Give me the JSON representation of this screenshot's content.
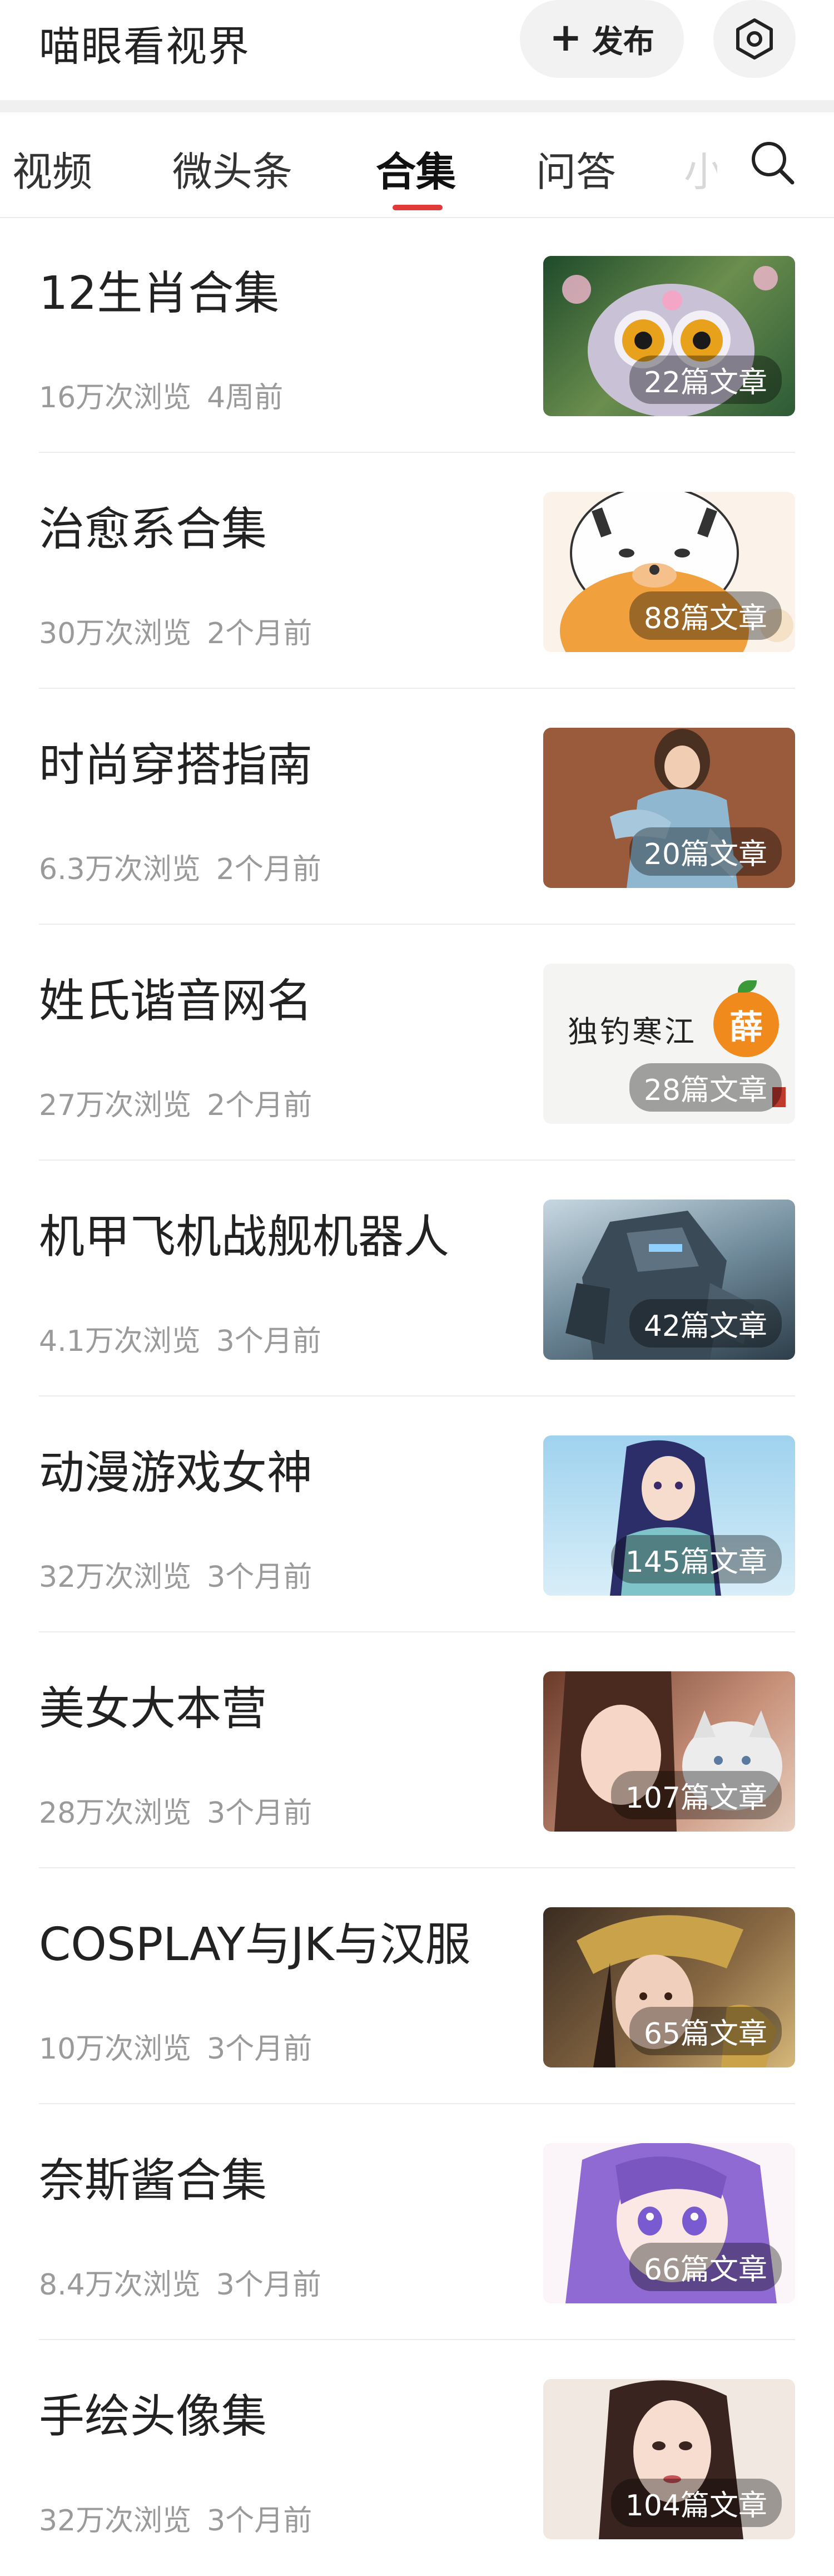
{
  "header": {
    "title": "喵眼看视界",
    "publish_label": "发布"
  },
  "tabs": [
    {
      "label": "视频"
    },
    {
      "label": "微头条"
    },
    {
      "label": "合集",
      "active": true
    },
    {
      "label": "问答"
    }
  ],
  "tab_overflow": "小",
  "collections": [
    {
      "title": "12生肖合集",
      "views": "16万次浏览",
      "time": "4周前",
      "count": "22篇文章",
      "thumb": "owl-creature"
    },
    {
      "title": "治愈系合集",
      "views": "30万次浏览",
      "time": "2个月前",
      "count": "88篇文章",
      "thumb": "cartoon-tiger"
    },
    {
      "title": "时尚穿搭指南",
      "views": "6.3万次浏览",
      "time": "2个月前",
      "count": "20篇文章",
      "thumb": "fashion-girl"
    },
    {
      "title": "姓氏谐音网名",
      "views": "27万次浏览",
      "time": "2个月前",
      "count": "28篇文章",
      "thumb": "calligraphy",
      "thumb_text": "独钓寒江",
      "thumb_seal": "薛"
    },
    {
      "title": "机甲飞机战舰机器人",
      "views": "4.1万次浏览",
      "time": "3个月前",
      "count": "42篇文章",
      "thumb": "mech-robot"
    },
    {
      "title": "动漫游戏女神",
      "views": "32万次浏览",
      "time": "3个月前",
      "count": "145篇文章",
      "thumb": "anime-goddess"
    },
    {
      "title": "美女大本营",
      "views": "28万次浏览",
      "time": "3个月前",
      "count": "107篇文章",
      "thumb": "girl-with-cat"
    },
    {
      "title": "COSPLAY与JK与汉服",
      "views": "10万次浏览",
      "time": "3个月前",
      "count": "65篇文章",
      "thumb": "golden-armor"
    },
    {
      "title": "奈斯酱合集",
      "views": "8.4万次浏览",
      "time": "3个月前",
      "count": "66篇文章",
      "thumb": "anime-purple-hair"
    },
    {
      "title": "手绘头像集",
      "views": "32万次浏览",
      "time": "3个月前",
      "count": "104篇文章",
      "thumb": "hand-drawn-portrait"
    }
  ],
  "colors": {
    "accent": "#e03a3a",
    "meta_text": "#9a9a9a"
  }
}
